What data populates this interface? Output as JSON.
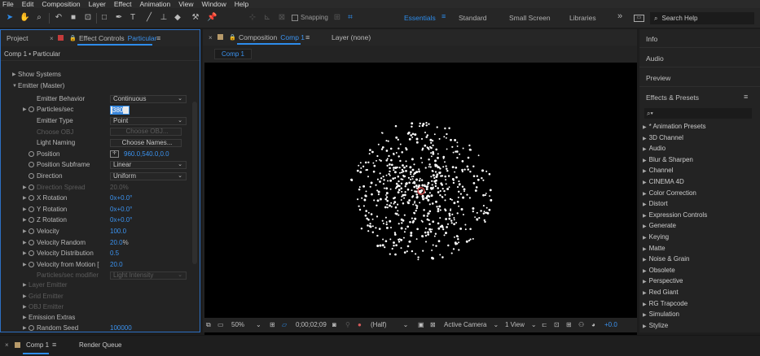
{
  "menu": [
    "File",
    "Edit",
    "Composition",
    "Layer",
    "Effect",
    "Animation",
    "View",
    "Window",
    "Help"
  ],
  "toolbar": {
    "snapping_label": "Snapping",
    "workspaces": [
      "Essentials",
      "Standard",
      "Small Screen",
      "Libraries"
    ],
    "active_workspace": "Essentials",
    "search_placeholder": "Search Help"
  },
  "left_panel": {
    "tab_project": "Project",
    "tab_effect_controls": "Effect Controls",
    "tab_effect_name": "Particular",
    "breadcrumb": "Comp 1 • Particular",
    "show_systems": "Show Systems",
    "emitter_master": "Emitter (Master)",
    "rows": [
      {
        "label": "Emitter Behavior",
        "kind": "select",
        "value": "Continuous"
      },
      {
        "label": "Particles/sec",
        "kind": "input",
        "value": "380",
        "stopwatch": true,
        "twirl": true
      },
      {
        "label": "Emitter Type",
        "kind": "select",
        "value": "Point"
      },
      {
        "label": "Choose OBJ",
        "kind": "button",
        "value": "Choose OBJ...",
        "dim": true
      },
      {
        "label": "Light Naming",
        "kind": "button",
        "value": "Choose Names..."
      },
      {
        "label": "Position",
        "kind": "position",
        "value": "960.0,540.0,0.0",
        "stopwatch": true
      },
      {
        "label": "Position Subframe",
        "kind": "select",
        "value": "Linear",
        "stopwatch": true
      },
      {
        "label": "Direction",
        "kind": "select",
        "value": "Uniform",
        "stopwatch": true
      },
      {
        "label": "Direction Spread",
        "kind": "text",
        "value": "20.0",
        "suffix": "%",
        "stopwatch": true,
        "twirl": true,
        "dim": true
      },
      {
        "label": "X Rotation",
        "kind": "text",
        "value": "0x+0.0°",
        "stopwatch": true,
        "twirl": true
      },
      {
        "label": "Y Rotation",
        "kind": "text",
        "value": "0x+0.0°",
        "stopwatch": true,
        "twirl": true
      },
      {
        "label": "Z Rotation",
        "kind": "text",
        "value": "0x+0.0°",
        "stopwatch": true,
        "twirl": true
      },
      {
        "label": "Velocity",
        "kind": "text",
        "value": "100.0",
        "stopwatch": true,
        "twirl": true
      },
      {
        "label": "Velocity Random",
        "kind": "text",
        "value": "20.0",
        "suffix": "%",
        "stopwatch": true,
        "twirl": true
      },
      {
        "label": "Velocity Distribution",
        "kind": "text",
        "value": "0.5",
        "stopwatch": true,
        "twirl": true
      },
      {
        "label": "Velocity from Motion [",
        "kind": "text",
        "value": "20.0",
        "stopwatch": true,
        "twirl": true
      },
      {
        "label": "Particles/sec modifier",
        "kind": "select",
        "value": "Light Intensity",
        "dim": true
      }
    ],
    "groups": [
      {
        "label": "Layer Emitter",
        "dim": true
      },
      {
        "label": "Grid Emitter",
        "dim": true
      },
      {
        "label": "OBJ Emitter",
        "dim": true
      },
      {
        "label": "Emission Extras",
        "dim": false
      }
    ],
    "random_seed": {
      "label": "Random Seed",
      "value": "100000"
    }
  },
  "comp_panel": {
    "tab_composition": "Composition",
    "tab_comp_name": "Comp 1",
    "tab_layer": "Layer (none)",
    "flow_tab": "Comp 1",
    "zoom": "50%",
    "timecode": "0;00;02;09",
    "resolution": "(Half)",
    "camera": "Active Camera",
    "views": "1 View",
    "exposure": "+0.0"
  },
  "right_panel": {
    "info": "Info",
    "audio": "Audio",
    "preview": "Preview",
    "effects_presets": "Effects & Presets",
    "search_placeholder": "",
    "categories": [
      "* Animation Presets",
      "3D Channel",
      "Audio",
      "Blur & Sharpen",
      "Channel",
      "CINEMA 4D",
      "Color Correction",
      "Distort",
      "Expression Controls",
      "Generate",
      "Keying",
      "Matte",
      "Noise & Grain",
      "Obsolete",
      "Perspective",
      "Red Giant",
      "RG Trapcode",
      "Simulation",
      "Stylize"
    ]
  },
  "bottom": {
    "comp_tab": "Comp 1",
    "render_queue": "Render Queue"
  },
  "colors": {
    "accent": "#2d8ceb",
    "particle": "#ffffff",
    "particle_core": "#d24a4a"
  }
}
